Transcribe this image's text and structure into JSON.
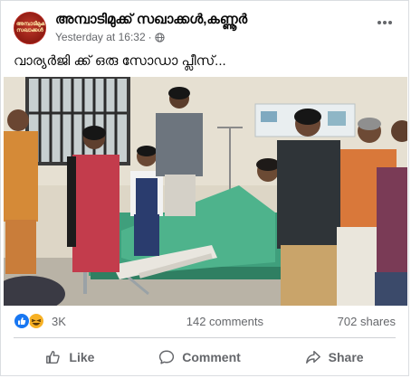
{
  "post": {
    "group_name": "അമ്പാടിമുക്ക് സഖാക്കൾ,കണ്ണൂർ",
    "time": "Yesterday at 16:32",
    "separator": "·",
    "privacy_icon": "globe-icon",
    "more_icon": "more-options-icon",
    "text": "വാര്യർജി ക്ക് ഒരു സോഡാ പ്ലീസ്...",
    "avatar_text": "അമ്പാടിമുക്ക് സഖാക്കൾ"
  },
  "stats": {
    "reaction_icons": [
      "like-reaction-icon",
      "haha-reaction-icon"
    ],
    "reaction_count": "3K",
    "comments": "142 comments",
    "shares": "702 shares"
  },
  "actions": {
    "like_label": "Like",
    "comment_label": "Comment",
    "share_label": "Share"
  },
  "colors": {
    "facebook_blue": "#1877f2",
    "haha_yellow": "#f7b125",
    "secondary_text": "#65676b",
    "avatar_red": "#b3261e"
  }
}
